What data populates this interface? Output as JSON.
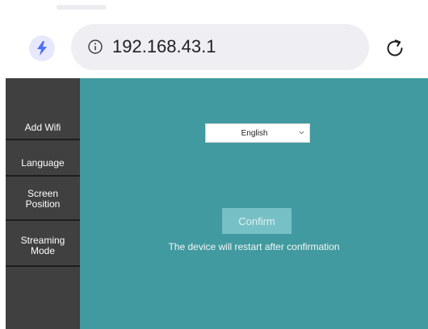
{
  "browser": {
    "url": "192.168.43.1",
    "left_icon": "lightning-bolt-icon",
    "info_icon": "info-icon",
    "reload_icon": "reload-icon"
  },
  "sidebar": {
    "items": [
      {
        "label": "Add Wifi"
      },
      {
        "label": "Language"
      },
      {
        "label": "Screen\nPosition"
      },
      {
        "label": "Streaming\nMode"
      }
    ]
  },
  "main": {
    "language_select": {
      "value": "English",
      "icon": "chevron-down-icon"
    },
    "confirm_label": "Confirm",
    "restart_note": "The device will restart after confirmation"
  },
  "colors": {
    "content_bg": "#419a9f",
    "sidebar_bg": "#404040",
    "confirm_bg": "#77c0c5",
    "bolt_accent": "#4f6df5"
  }
}
